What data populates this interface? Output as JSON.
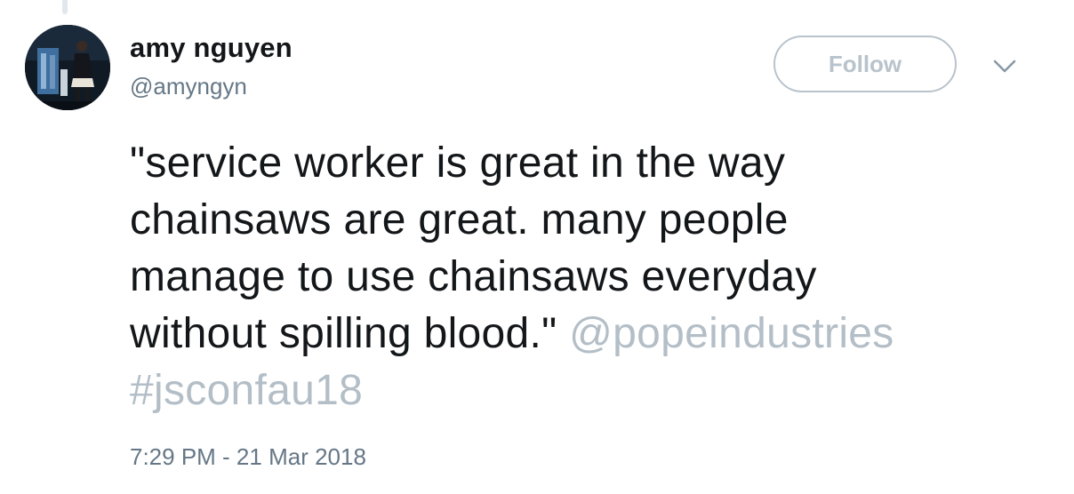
{
  "tweet": {
    "author": {
      "display_name": "amy nguyen",
      "handle": "@amyngyn"
    },
    "follow_label": "Follow",
    "text_lines": [
      "\"service worker is great in the way",
      "chainsaws are great. many people",
      "manage to use chainsaws everyday",
      "without spilling blood.\" "
    ],
    "mention": "@popeindustries",
    "hashtag": "#jsconfau18",
    "timestamp": "7:29 PM - 21 Mar 2018"
  },
  "colors": {
    "text": "#14171a",
    "secondary": "#657786",
    "muted_link": "#b3bec7",
    "button_border": "#b8c3cc"
  },
  "icons": {
    "caret": "chevron-down-icon"
  }
}
